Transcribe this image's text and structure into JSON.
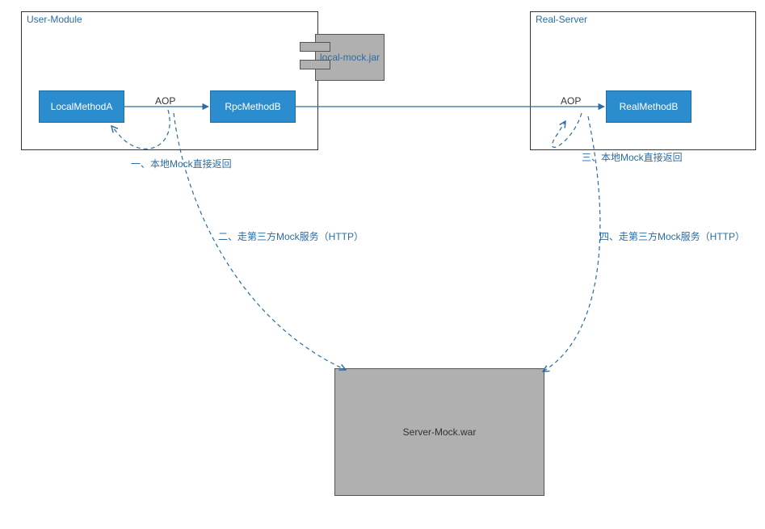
{
  "modules": {
    "user": {
      "title": "User-Module"
    },
    "real": {
      "title": "Real-Server"
    }
  },
  "boxes": {
    "localMethodA": "LocalMethodA",
    "rpcMethodB": "RpcMethodB",
    "realMethodB": "RealMethodB",
    "localMockJar": "local-mock.jar",
    "serverMockWar": "Server-Mock.war"
  },
  "labels": {
    "aop1": "AOP",
    "aop2": "AOP",
    "note1": "一、本地Mock直接返回",
    "note2": "二、走第三方Mock服务（HTTP）",
    "note3": "三、本地Mock直接返回",
    "note4": "四、走第三方Mock服务（HTTP）"
  },
  "chart_data": {
    "type": "diagram",
    "title": "",
    "nodes": [
      {
        "id": "user-module",
        "label": "User-Module",
        "type": "container"
      },
      {
        "id": "real-server",
        "label": "Real-Server",
        "type": "container"
      },
      {
        "id": "local-method-a",
        "label": "LocalMethodA",
        "parent": "user-module",
        "type": "process"
      },
      {
        "id": "rpc-method-b",
        "label": "RpcMethodB",
        "parent": "user-module",
        "type": "process"
      },
      {
        "id": "real-method-b",
        "label": "RealMethodB",
        "parent": "real-server",
        "type": "process"
      },
      {
        "id": "local-mock-jar",
        "label": "local-mock.jar",
        "type": "component"
      },
      {
        "id": "server-mock-war",
        "label": "Server-Mock.war",
        "type": "component"
      }
    ],
    "edges": [
      {
        "from": "local-method-a",
        "to": "rpc-method-b",
        "label": "AOP",
        "style": "solid"
      },
      {
        "from": "rpc-method-b",
        "to": "real-method-b",
        "label": "AOP",
        "style": "solid"
      },
      {
        "from": "local-method-a",
        "to": "local-method-a",
        "label": "一、本地Mock直接返回",
        "style": "dashed-return",
        "via": "aop"
      },
      {
        "from": "local-method-a",
        "to": "server-mock-war",
        "label": "二、走第三方Mock服务（HTTP）",
        "style": "dashed",
        "via": "aop"
      },
      {
        "from": "real-method-b",
        "to": "real-method-b",
        "label": "三、本地Mock直接返回",
        "style": "dashed-return",
        "via": "aop"
      },
      {
        "from": "real-method-b",
        "to": "server-mock-war",
        "label": "四、走第三方Mock服务（HTTP）",
        "style": "dashed",
        "via": "aop"
      }
    ]
  }
}
